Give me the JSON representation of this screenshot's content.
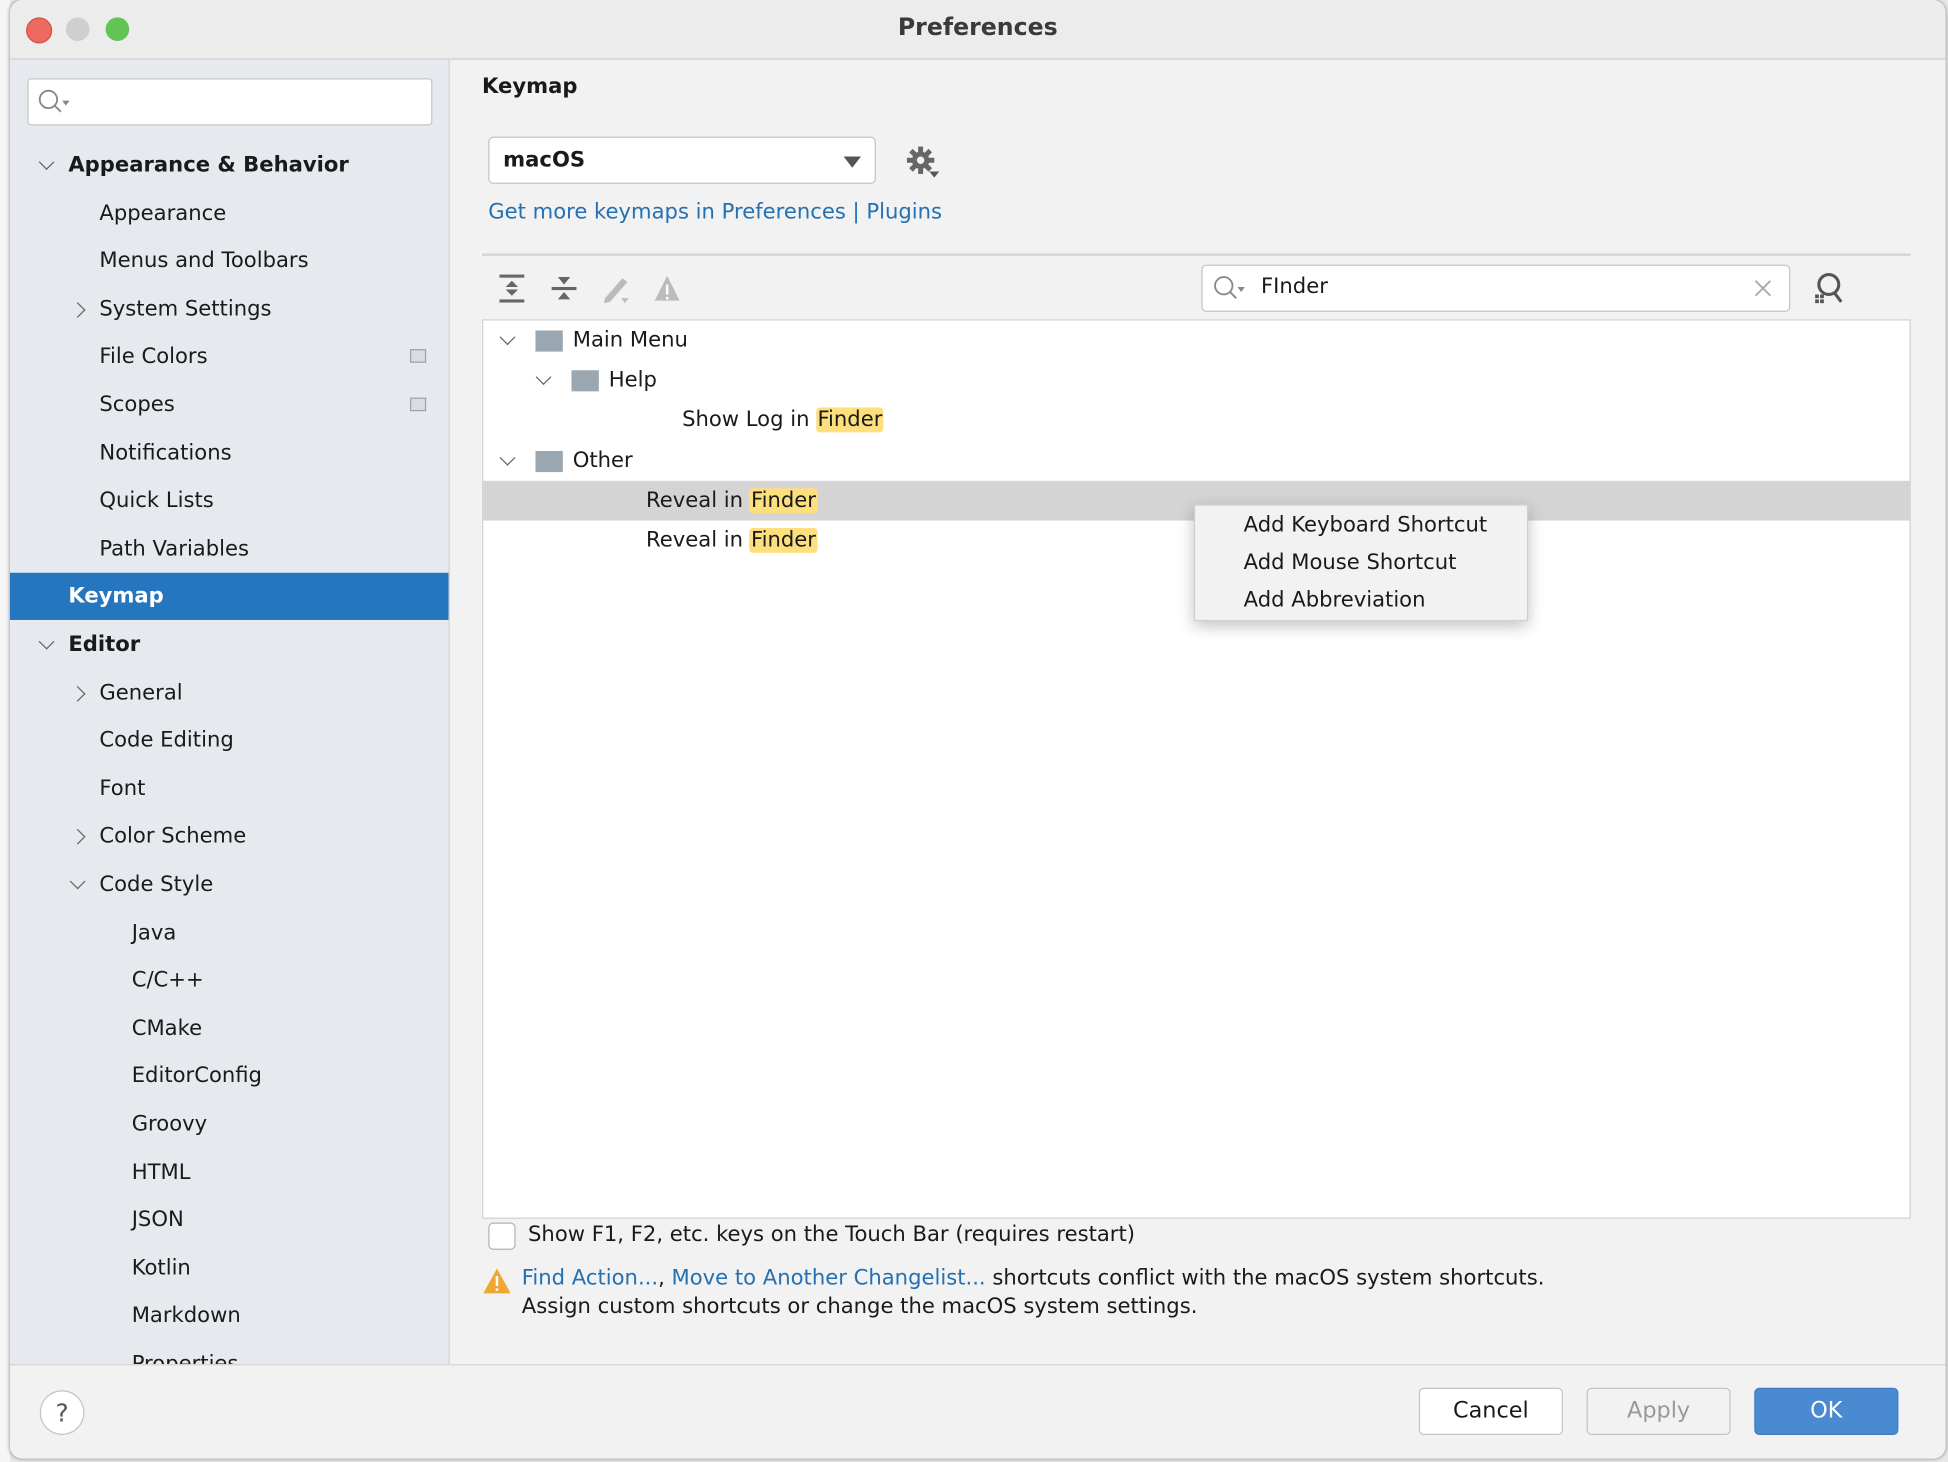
{
  "window": {
    "title": "Preferences"
  },
  "sidebar": {
    "search_placeholder": "",
    "items": [
      {
        "label": "Appearance & Behavior",
        "level": 0,
        "expander": "expanded",
        "bold": true
      },
      {
        "label": "Appearance",
        "level": 1
      },
      {
        "label": "Menus and Toolbars",
        "level": 1
      },
      {
        "label": "System Settings",
        "level": 1,
        "expander": "collapsed"
      },
      {
        "label": "File Colors",
        "level": 1,
        "project_icon": true
      },
      {
        "label": "Scopes",
        "level": 1,
        "project_icon": true
      },
      {
        "label": "Notifications",
        "level": 1
      },
      {
        "label": "Quick Lists",
        "level": 1
      },
      {
        "label": "Path Variables",
        "level": 1
      },
      {
        "label": "Keymap",
        "level": 0,
        "selected": true
      },
      {
        "label": "Editor",
        "level": 0,
        "expander": "expanded",
        "bold": true
      },
      {
        "label": "General",
        "level": 1,
        "expander": "collapsed"
      },
      {
        "label": "Code Editing",
        "level": 1
      },
      {
        "label": "Font",
        "level": 1
      },
      {
        "label": "Color Scheme",
        "level": 1,
        "expander": "collapsed"
      },
      {
        "label": "Code Style",
        "level": 1,
        "expander": "expanded"
      },
      {
        "label": "Java",
        "level": 2
      },
      {
        "label": "C/C++",
        "level": 2
      },
      {
        "label": "CMake",
        "level": 2
      },
      {
        "label": "EditorConfig",
        "level": 2
      },
      {
        "label": "Groovy",
        "level": 2
      },
      {
        "label": "HTML",
        "level": 2
      },
      {
        "label": "JSON",
        "level": 2
      },
      {
        "label": "Kotlin",
        "level": 2
      },
      {
        "label": "Markdown",
        "level": 2
      },
      {
        "label": "Properties",
        "level": 2
      }
    ]
  },
  "main": {
    "heading": "Keymap",
    "keymap_select": "macOS",
    "link_prefix": "Get more keymaps in Preferences | ",
    "link_plugins": "Plugins",
    "toolbar": [
      "expand-all-icon",
      "collapse-all-icon",
      "edit-shortcut-icon",
      "conflicts-warning-icon"
    ],
    "search_value": "FInder",
    "tree": [
      {
        "label": "Main Menu",
        "level": 0,
        "folder": true,
        "expanded": true
      },
      {
        "label": "Help",
        "level": 1,
        "folder": true,
        "expanded": true
      },
      {
        "prefix": "Show Log in ",
        "match": "Finder",
        "level": 2
      },
      {
        "label": "Other",
        "level": 0,
        "folder": true,
        "expanded": true
      },
      {
        "prefix": "Reveal in ",
        "match": "Finder",
        "level": 1,
        "selected": true
      },
      {
        "prefix": "Reveal in ",
        "match": "Finder",
        "level": 1
      }
    ],
    "context_menu": [
      "Add Keyboard Shortcut",
      "Add Mouse Shortcut",
      "Add Abbreviation"
    ],
    "touchbar_checkbox": {
      "label": "Show F1, F2, etc. keys on the Touch Bar (requires restart)",
      "checked": false
    },
    "warning": {
      "link1": "Find Action...",
      "sep": ", ",
      "link2": "Move to Another Changelist...",
      "text1": " shortcuts conflict with the macOS system shortcuts.",
      "text2": "Assign custom shortcuts or change the macOS system settings."
    }
  },
  "footer": {
    "help": "?",
    "cancel": "Cancel",
    "apply": "Apply",
    "ok": "OK"
  },
  "colors": {
    "accent": "#2675bf",
    "link": "#2470b3",
    "highlight": "#fedf7e",
    "ok": "#4a8ad0"
  }
}
